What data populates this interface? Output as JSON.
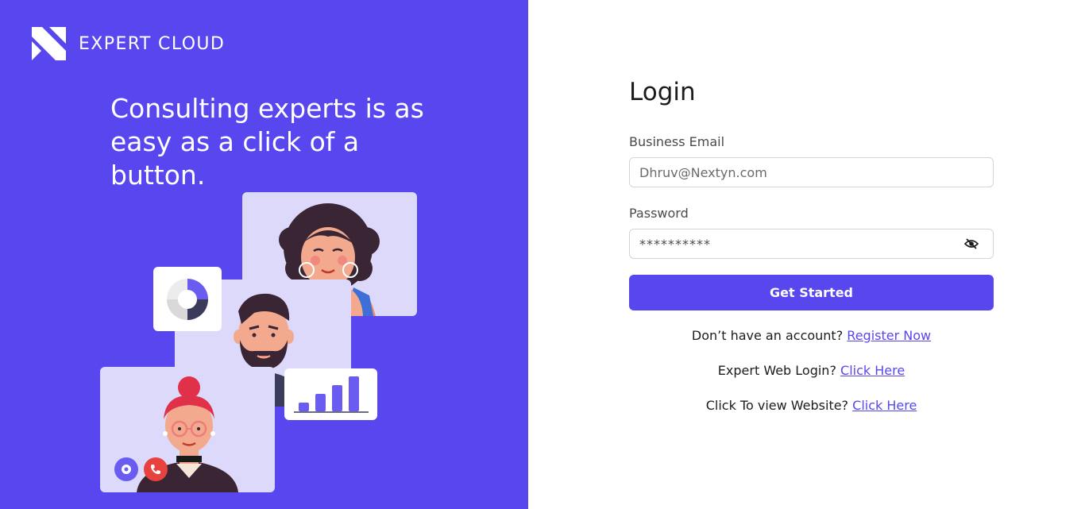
{
  "brand": {
    "name": "EXPERT CLOUD",
    "logo_icon": "expert-cloud-logo"
  },
  "hero": {
    "tagline": "Consulting experts is as easy as a click of a button."
  },
  "illustration": {
    "icons": [
      "donut-chart-icon",
      "bar-chart-icon",
      "record-icon",
      "phone-icon"
    ]
  },
  "login": {
    "title": "Login",
    "email": {
      "label": "Business Email",
      "value": "Dhruv@Nextyn.com"
    },
    "password": {
      "label": "Password",
      "value": "**********",
      "toggle_icon": "eye-slash-icon"
    },
    "submit_label": "Get Started",
    "register": {
      "text": "Don’t have an account?",
      "link": "Register Now"
    },
    "expert_login": {
      "text": "Expert Web Login?",
      "link": "Click Here"
    },
    "website": {
      "text": "Click To view Website?",
      "link": "Click Here"
    }
  },
  "colors": {
    "brand_purple": "#5847ee",
    "card_lavender": "#dcd9fb",
    "text_dark": "#1c1c1c"
  }
}
